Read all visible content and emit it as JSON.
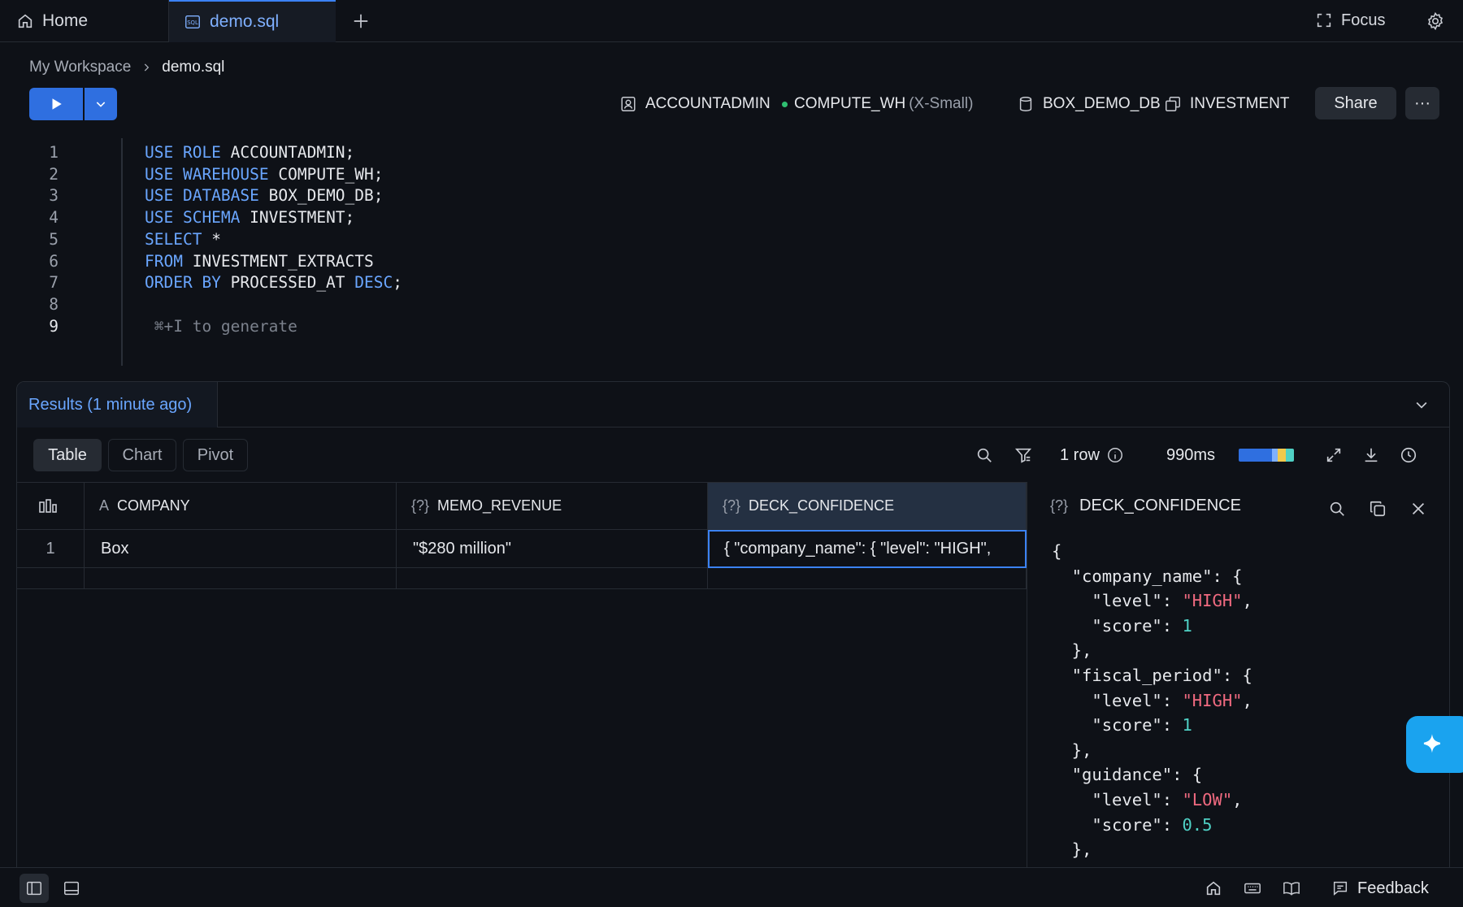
{
  "tabs": {
    "home_label": "Home",
    "file_label": "demo.sql",
    "focus_label": "Focus"
  },
  "breadcrumb": {
    "workspace": "My Workspace",
    "file": "demo.sql"
  },
  "context": {
    "role": "ACCOUNTADMIN",
    "warehouse": "COMPUTE_WH",
    "warehouse_size": "(X-Small)",
    "database": "BOX_DEMO_DB",
    "schema": "INVESTMENT",
    "share_label": "Share",
    "more_label": "···"
  },
  "editor": {
    "line_numbers": [
      "1",
      "2",
      "3",
      "4",
      "5",
      "6",
      "7",
      "8",
      "9"
    ],
    "lines": [
      [
        {
          "t": "USE ROLE",
          "k": true
        },
        {
          "t": " ACCOUNTADMIN;",
          "k": false
        }
      ],
      [
        {
          "t": "USE WAREHOUSE",
          "k": true
        },
        {
          "t": " COMPUTE_WH;",
          "k": false
        }
      ],
      [
        {
          "t": "USE DATABASE",
          "k": true
        },
        {
          "t": " BOX_DEMO_DB;",
          "k": false
        }
      ],
      [
        {
          "t": "USE SCHEMA",
          "k": true
        },
        {
          "t": " INVESTMENT;",
          "k": false
        }
      ],
      [
        {
          "t": "SELECT",
          "k": true
        },
        {
          "t": " *",
          "k": false
        }
      ],
      [
        {
          "t": "FROM",
          "k": true
        },
        {
          "t": " INVESTMENT_EXTRACTS",
          "k": false
        }
      ],
      [
        {
          "t": "ORDER BY",
          "k": true
        },
        {
          "t": " PROCESSED_AT ",
          "k": false
        },
        {
          "t": "DESC",
          "k": true
        },
        {
          "t": ";",
          "k": false
        }
      ],
      [],
      []
    ],
    "hint": "⌘+I to generate"
  },
  "results": {
    "tab_label": "Results (1 minute ago)",
    "views": [
      "Table",
      "Chart",
      "Pivot"
    ],
    "row_count": "1 row",
    "duration": "990ms",
    "duration_segments": [
      {
        "color": "#2f6fe0",
        "fraction": 0.6
      },
      {
        "color": "#7fb0ff",
        "fraction": 0.1
      },
      {
        "color": "#f2c94c",
        "fraction": 0.15
      },
      {
        "color": "#4fd1c5",
        "fraction": 0.15
      }
    ]
  },
  "grid": {
    "columns": [
      {
        "type_icon": "A",
        "name": "COMPANY"
      },
      {
        "type_icon": "{?}",
        "name": "MEMO_REVENUE"
      },
      {
        "type_icon": "{?}",
        "name": "DECK_CONFIDENCE"
      }
    ],
    "rows": [
      {
        "index": "1",
        "cells": [
          "Box",
          "\"$280 million\"",
          "{  \"company_name\": {    \"level\": \"HIGH\","
        ]
      }
    ]
  },
  "inspector": {
    "type_icon": "{?}",
    "title": "DECK_CONFIDENCE",
    "json_lines": [
      [
        {
          "t": "{",
          "c": "p"
        }
      ],
      [
        {
          "t": "  \"company_name\": {",
          "c": "p"
        }
      ],
      [
        {
          "t": "    \"level\": ",
          "c": "p"
        },
        {
          "t": "\"HIGH\"",
          "c": "s"
        },
        {
          "t": ",",
          "c": "p"
        }
      ],
      [
        {
          "t": "    \"score\": ",
          "c": "p"
        },
        {
          "t": "1",
          "c": "n"
        }
      ],
      [
        {
          "t": "  },",
          "c": "p"
        }
      ],
      [
        {
          "t": "  \"fiscal_period\": {",
          "c": "p"
        }
      ],
      [
        {
          "t": "    \"level\": ",
          "c": "p"
        },
        {
          "t": "\"HIGH\"",
          "c": "s"
        },
        {
          "t": ",",
          "c": "p"
        }
      ],
      [
        {
          "t": "    \"score\": ",
          "c": "p"
        },
        {
          "t": "1",
          "c": "n"
        }
      ],
      [
        {
          "t": "  },",
          "c": "p"
        }
      ],
      [
        {
          "t": "  \"guidance\": {",
          "c": "p"
        }
      ],
      [
        {
          "t": "    \"level\": ",
          "c": "p"
        },
        {
          "t": "\"LOW\"",
          "c": "s"
        },
        {
          "t": ",",
          "c": "p"
        }
      ],
      [
        {
          "t": "    \"score\": ",
          "c": "p"
        },
        {
          "t": "0.5",
          "c": "n"
        }
      ],
      [
        {
          "t": "  },",
          "c": "p"
        }
      ]
    ]
  },
  "bottom": {
    "feedback_label": "Feedback"
  },
  "colors": {
    "accent": "#2f6fe0",
    "keyword": "#6aa6ff",
    "json_string": "#f06a80",
    "json_number": "#4fd1c5",
    "status_dot": "#2fbf71"
  }
}
